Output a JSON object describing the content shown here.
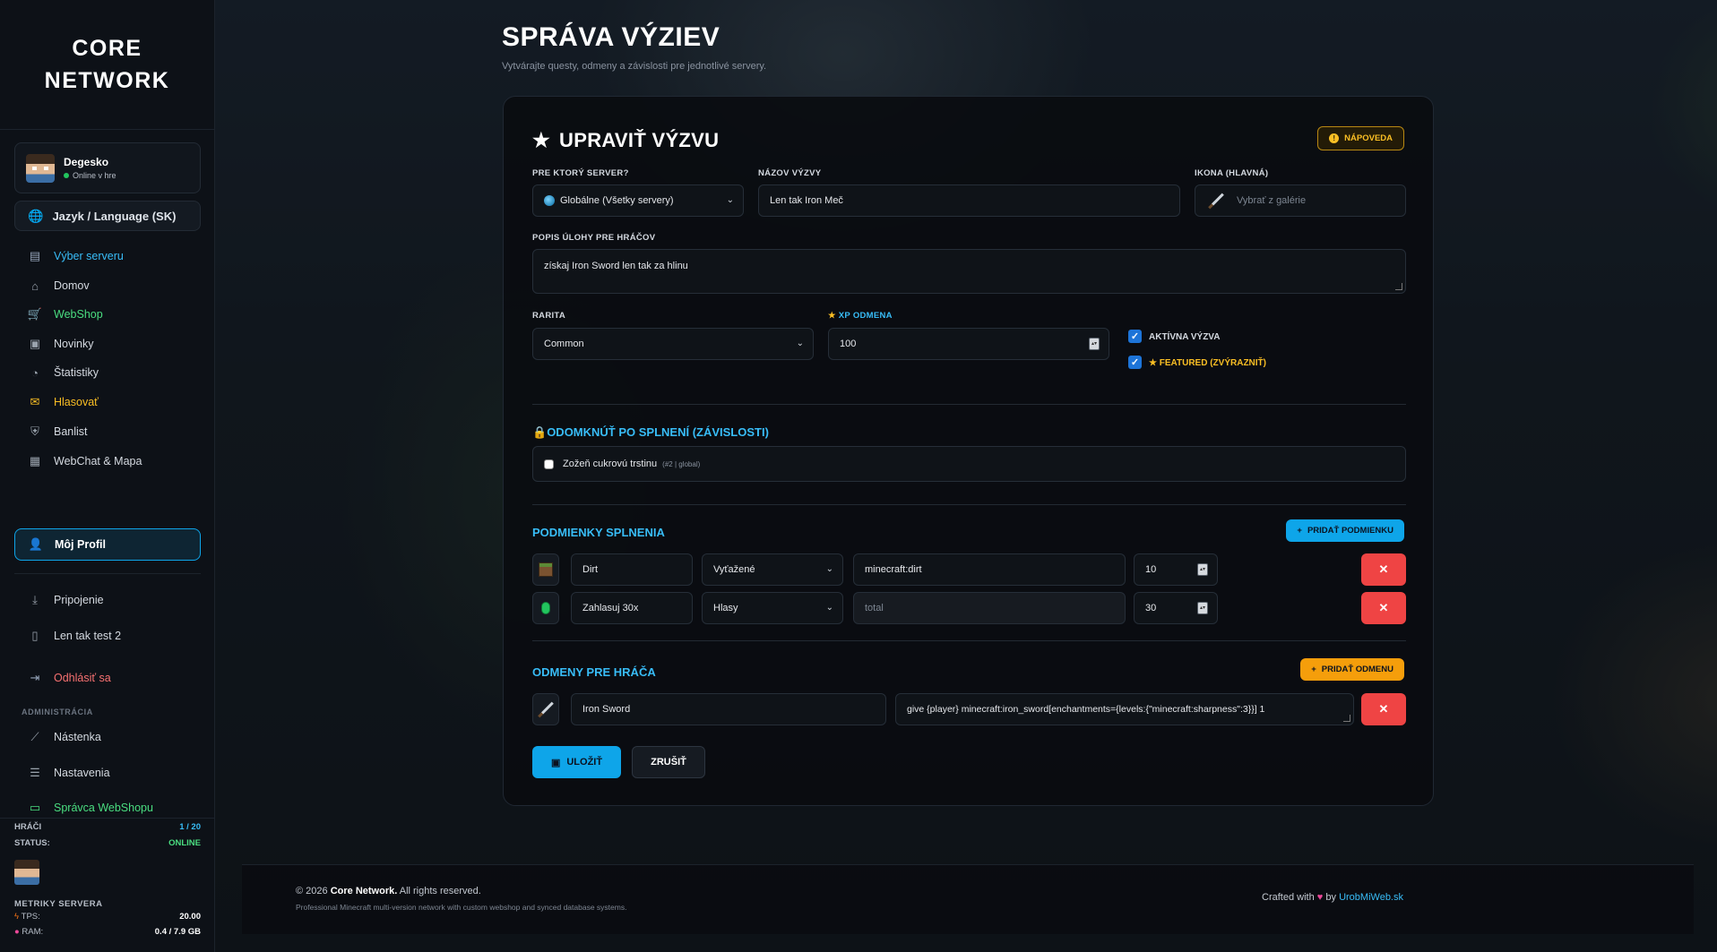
{
  "brand": {
    "line1": "CORE",
    "line2": "NETWORK"
  },
  "user": {
    "name": "Degesko",
    "status": "Online v hre"
  },
  "language_label": "Jazyk / Language (SK)",
  "nav": {
    "server_select": "Výber serveru",
    "home": "Domov",
    "webshop": "WebShop",
    "news": "Novinky",
    "stats": "Štatistiky",
    "vote": "Hlasovať",
    "banlist": "Banlist",
    "webchat": "WebChat & Mapa",
    "profile": "Môj Profil",
    "connect": "Pripojenie",
    "test": "Len tak test 2",
    "logout": "Odhlásiť sa",
    "admin_label": "ADMINISTRÁCIA",
    "dashboard": "Nástenka",
    "settings": "Nastavenia",
    "shop_admin": "Správca WebShopu"
  },
  "server_status": {
    "players_label": "HRÁČI",
    "players_value": "1 / 20",
    "status_label": "STATUS:",
    "status_value": "ONLINE",
    "metrics_label": "METRIKY SERVERA",
    "tps_label": "TPS:",
    "tps_value": "20.00",
    "ram_label": "RAM:",
    "ram_value": "0.4 / 7.9 GB"
  },
  "page": {
    "title": "SPRÁVA VÝZIEV",
    "subtitle": "Vytvárajte questy, odmeny a závislosti pre jednotlivé servery."
  },
  "form": {
    "title": "UPRAVIŤ VÝZVU",
    "help": "NÁPOVEDA",
    "server_label": "PRE KTORÝ SERVER?",
    "server_value": "Globálne (Všetky servery)",
    "name_label": "NÁZOV VÝZVY",
    "name_value": "Len tak Iron Meč",
    "icon_label": "IKONA (HLAVNÁ)",
    "icon_placeholder": "Vybrať z galérie",
    "desc_label": "POPIS ÚLOHY PRE HRÁČOV",
    "desc_value": "získaj Iron Sword len tak za hlinu",
    "rarity_label": "RARITA",
    "rarity_value": "Common",
    "xp_label": "XP ODMENA",
    "xp_value": "100",
    "active_label": "AKTÍVNA VÝZVA",
    "featured_label": "FEATURED (ZVÝRAZNIŤ)",
    "unlock_title": "ODOMKNÚŤ PO SPLNENÍ (ZÁVISLOSTI)",
    "dep_name": "Zožeň cukrovú trstinu",
    "dep_meta": "(#2 | global)",
    "cond_title": "PODMIENKY SPLNENIA",
    "add_cond": "PRIDAŤ PODMIENKU",
    "conditions": [
      {
        "name": "Dirt",
        "type": "Vyťažené",
        "target": "minecraft:dirt",
        "amount": "10"
      },
      {
        "name": "Zahlasuj 30x",
        "type": "Hlasy",
        "target": "total",
        "amount": "30"
      }
    ],
    "rewards_title": "ODMENY PRE HRÁČA",
    "add_reward": "PRIDAŤ ODMENU",
    "reward": {
      "name": "Iron Sword",
      "command": "give {player} minecraft:iron_sword[enchantments={levels:{\"minecraft:sharpness\":3}}] 1"
    },
    "save": "ULOŽIŤ",
    "cancel": "ZRUŠIŤ"
  },
  "footer": {
    "copyright_prefix": "© 2026",
    "copyright_brand": "Core Network.",
    "copyright_suffix": "All rights reserved.",
    "tagline": "Professional Minecraft multi-version network with custom webshop and synced database systems.",
    "crafted_prefix": "Crafted with",
    "crafted_by": "by",
    "crafted_link": "UrobMiWeb.sk"
  },
  "colors": {
    "accent": "#0ea5e9",
    "success": "#4ade80",
    "warning": "#fbbf24",
    "danger": "#ef4444"
  }
}
